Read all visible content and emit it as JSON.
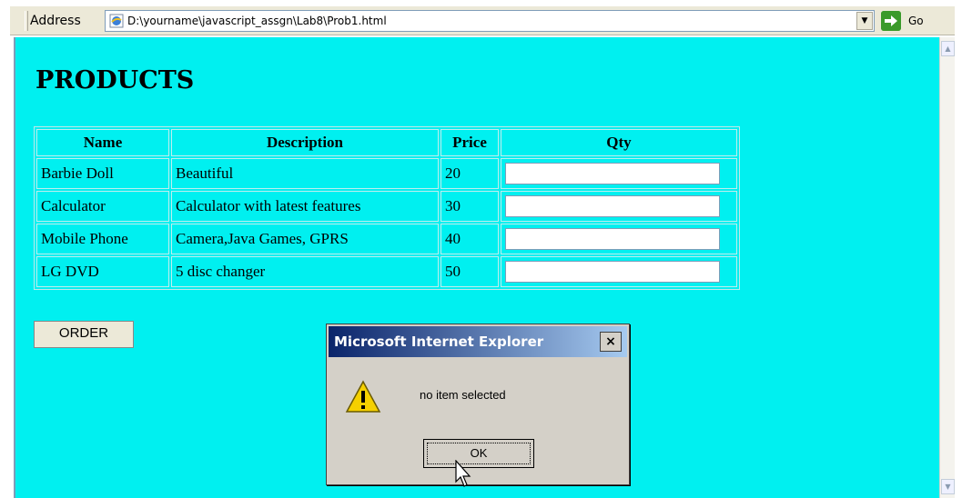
{
  "address_bar": {
    "label": "Address",
    "url": "D:\\yourname\\javascript_assgn\\Lab8\\Prob1.html",
    "go_label": "Go"
  },
  "page": {
    "title": "PRODUCTS",
    "table": {
      "headers": [
        "Name",
        "Description",
        "Price",
        "Qty"
      ],
      "rows": [
        {
          "name": "Barbie Doll",
          "description": "Beautiful",
          "price": "20",
          "qty": ""
        },
        {
          "name": "Calculator",
          "description": "Calculator with latest features",
          "price": "30",
          "qty": ""
        },
        {
          "name": "Mobile Phone",
          "description": "Camera,Java Games, GPRS",
          "price": "40",
          "qty": ""
        },
        {
          "name": "LG DVD",
          "description": "5 disc changer",
          "price": "50",
          "qty": ""
        }
      ]
    },
    "order_label": "ORDER",
    "background_color": "#00f0f0"
  },
  "dialog": {
    "title": "Microsoft Internet Explorer",
    "close_label": "×",
    "message": "no item selected",
    "ok_label": "OK",
    "icon": "warning-icon"
  }
}
